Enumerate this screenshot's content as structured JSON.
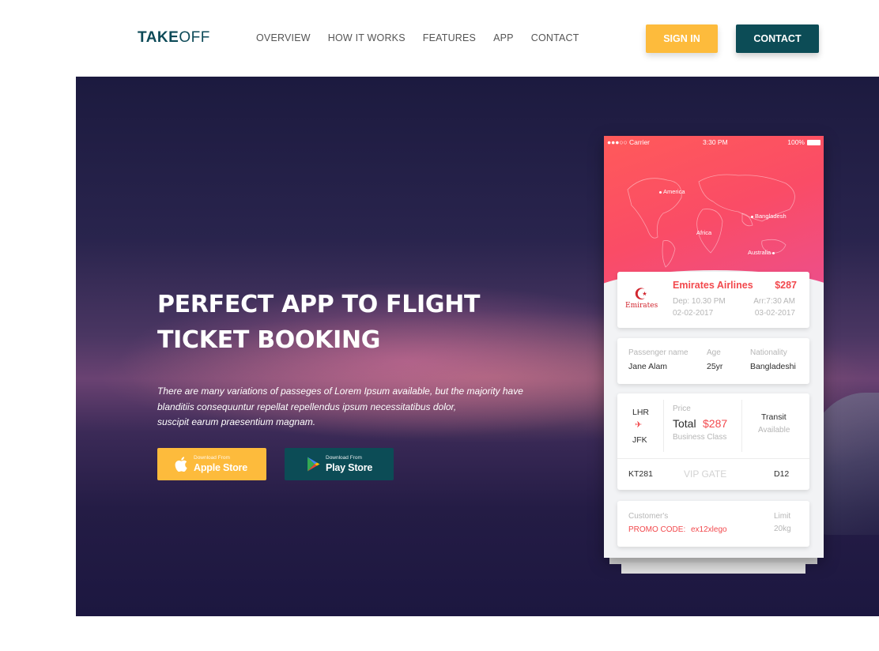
{
  "header": {
    "logo_bold": "TAKE",
    "logo_light": "OFF",
    "nav": [
      "OVERVIEW",
      "HOW IT WORKS",
      "FEATURES",
      "APP",
      "CONTACT"
    ],
    "signin_label": "SIGN IN",
    "contact_label": "CONTACT"
  },
  "hero": {
    "title_line1": "PERFECT APP TO FLIGHT",
    "title_line2": "TICKET BOOKING",
    "desc_line1": "There are many variations of passeges of Lorem Ipsum available, but the majority have",
    "desc_line2": "blanditiis consequuntur repellat repellendus ipsum necessitatibus dolor,",
    "desc_line3": "suscipit earum praesentium magnam.",
    "apple": {
      "small": "Download From",
      "big": "Apple Store"
    },
    "play": {
      "small": "Download From",
      "big": "Play Store"
    }
  },
  "phone": {
    "status": {
      "carrier": "●●●○○ Carrier",
      "time": "3:30 PM",
      "battery": "100%"
    },
    "map_labels": {
      "america": "America",
      "bangladesh": "Bangladesh",
      "africa": "Africa",
      "australia": "Australia"
    },
    "flight": {
      "airline": "Emirates Airlines",
      "price": "$287",
      "logo_text": "Emirates",
      "dep": "Dep: 10.30 PM",
      "arr": "Arr:7:30 AM",
      "dep_date": "02-02-2017",
      "arr_date": "03-02-2017"
    },
    "passenger": {
      "name_label": "Passenger name",
      "age_label": "Age",
      "nationality_label": "Nationality",
      "name": "Jane Alam",
      "age": "25yr",
      "nationality": "Bangladeshi"
    },
    "route": {
      "from": "LHR",
      "to": "JFK",
      "price_label": "Price",
      "total_label": "Total",
      "total_value": "$287",
      "class": "Business Class",
      "transit_label": "Transit",
      "transit_value": "Available",
      "flight_no": "KT281",
      "gate_label": "VIP GATE",
      "gate": "D12"
    },
    "customer": {
      "label": "Customer's",
      "promo_label": "PROMO CODE:",
      "promo_code": "ex12xlego",
      "limit_label": "Limit",
      "limit_value": "20kg"
    }
  },
  "colors": {
    "brand_dark": "#0c4c56",
    "accent_yellow": "#fdbb3c",
    "accent_red": "#f2494d"
  }
}
